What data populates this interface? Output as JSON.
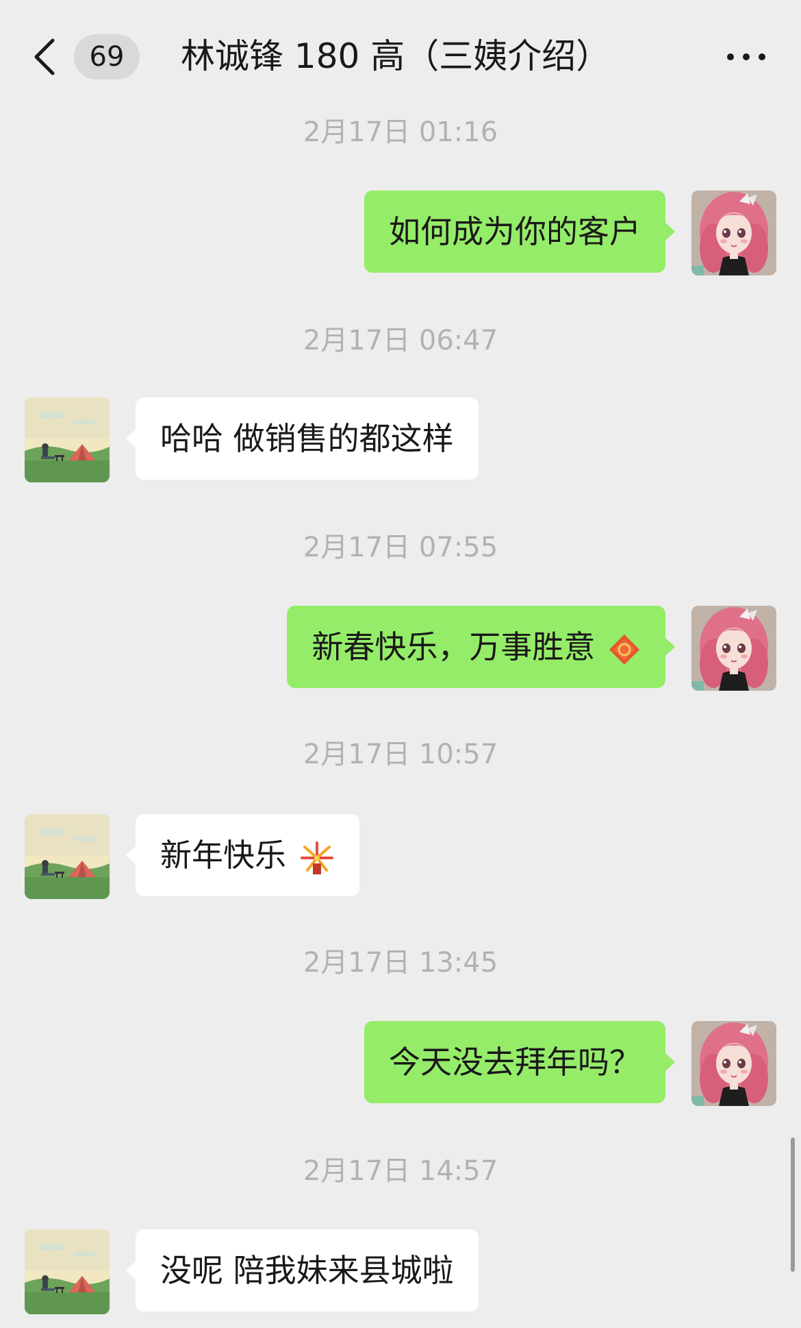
{
  "header": {
    "unread_count": "69",
    "title": "林诚锋 180 高（三姨介绍）",
    "back_icon": "chevron-left-icon",
    "more_icon": "more-dots-icon"
  },
  "messages": [
    {
      "timestamp": "2月17日 01:16",
      "from": "me",
      "text": "如何成为你的客户"
    },
    {
      "timestamp": "2月17日 06:47",
      "from": "them",
      "text": "哈哈 做销售的都这样"
    },
    {
      "timestamp": "2月17日 07:55",
      "from": "me",
      "text": "新春快乐，万事胜意",
      "emoji": "lucky-diamond-emoji"
    },
    {
      "timestamp": "2月17日 10:57",
      "from": "them",
      "text": "新年快乐",
      "emoji": "fireworks-emoji"
    },
    {
      "timestamp": "2月17日 13:45",
      "from": "me",
      "text": "今天没去拜年吗？"
    },
    {
      "timestamp": "2月17日 14:57",
      "from": "them",
      "text": "没呢 陪我妹来县城啦"
    }
  ],
  "colors": {
    "background": "#ededed",
    "my_bubble": "#95ec69",
    "their_bubble": "#ffffff",
    "timestamp": "#b2b2b2"
  }
}
